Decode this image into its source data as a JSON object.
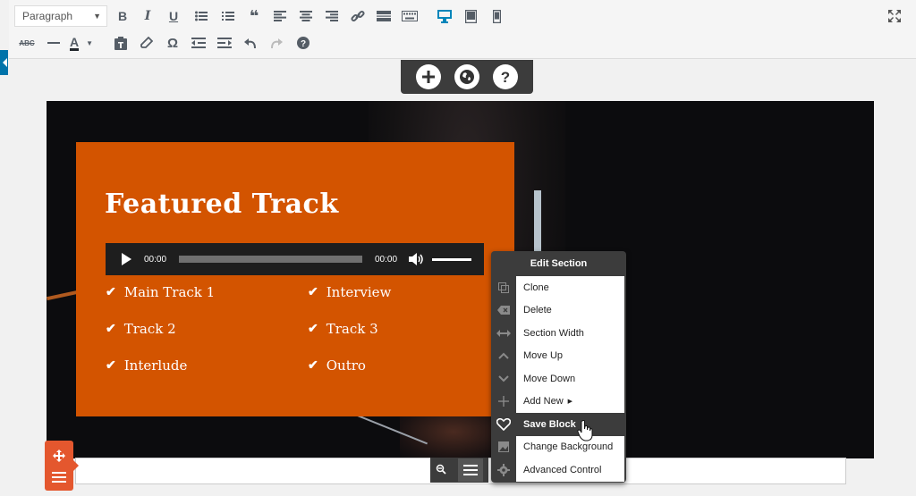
{
  "toolbar": {
    "format_select": {
      "value": "Paragraph"
    },
    "row1_icons": [
      "bold-icon",
      "italic-icon",
      "underline-icon",
      "bulleted-list-icon",
      "numbered-list-icon",
      "blockquote-icon",
      "align-left-icon",
      "align-center-icon",
      "align-right-icon",
      "link-icon",
      "read-more-icon",
      "keyboard-icon",
      "desktop-preview-icon",
      "tablet-preview-icon",
      "mobile-preview-icon"
    ],
    "row2_icons": [
      "strikethrough-icon",
      "horizontal-rule-icon",
      "text-color-icon",
      "paste-as-text-icon",
      "clear-formatting-icon",
      "special-character-icon",
      "outdent-icon",
      "indent-icon",
      "undo-icon",
      "redo-icon",
      "help-icon"
    ],
    "bold_label": "B",
    "italic_label": "I",
    "underline_label": "U",
    "omega_label": "Ω",
    "strike_label": "ABC",
    "text_color_label": "A",
    "accent_color": "#0085ba"
  },
  "builder_bar": {
    "icons": [
      "add-icon",
      "globe-icon",
      "help-icon"
    ]
  },
  "section": {
    "title": "Featured Track",
    "card_color": "#d35400",
    "player": {
      "current_time": "00:00",
      "duration": "00:00"
    },
    "tracks": [
      "Main Track 1",
      "Interview",
      "Track 2",
      "Track 3",
      "Interlude",
      "Outro"
    ]
  },
  "edit_menu": {
    "title": "Edit Section",
    "items": [
      {
        "label": "Clone",
        "icon": "clone-icon"
      },
      {
        "label": "Delete",
        "icon": "delete-icon"
      },
      {
        "label": "Section Width",
        "icon": "width-arrows-icon"
      },
      {
        "label": "Move Up",
        "icon": "chevron-up-icon"
      },
      {
        "label": "Move Down",
        "icon": "chevron-down-icon"
      },
      {
        "label": "Add New",
        "icon": "plus-icon",
        "submenu": true
      },
      {
        "label": "Save Block",
        "icon": "heart-icon",
        "active": true
      },
      {
        "label": "Change Background",
        "icon": "image-icon"
      },
      {
        "label": "Advanced Control",
        "icon": "gear-icon"
      }
    ]
  }
}
